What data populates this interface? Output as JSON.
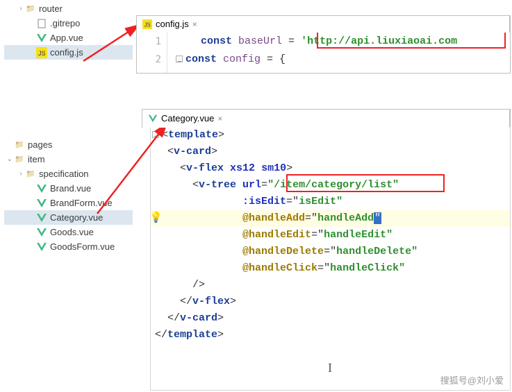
{
  "treeTop": {
    "rows": [
      {
        "indent": 1,
        "chevron": "›",
        "icon": "folder",
        "label": "router"
      },
      {
        "indent": 2,
        "chevron": "",
        "icon": "file",
        "label": ".gitrepo"
      },
      {
        "indent": 2,
        "chevron": "",
        "icon": "vue",
        "label": "App.vue"
      },
      {
        "indent": 2,
        "chevron": "",
        "icon": "js",
        "label": "config.js",
        "selected": true
      }
    ]
  },
  "tabTop": {
    "icon": "js",
    "label": "config.js",
    "close": "×"
  },
  "editorTop": {
    "ln1": "1",
    "ln2": "2",
    "l1_kw": "const ",
    "l1_ident": "baseUrl",
    "l1_eq": " = ",
    "l1_qo": "'",
    "l1_str": "http://api.liuxiaoai.com",
    "l2_kw": "const ",
    "l2_ident": "config",
    "l2_rest": " = {"
  },
  "treeBot": {
    "rows": [
      {
        "indent": 0,
        "chevron": "",
        "icon": "folder",
        "label": "pages"
      },
      {
        "indent": 0,
        "chevron": "⌄",
        "icon": "folder",
        "label": "item"
      },
      {
        "indent": 1,
        "chevron": "›",
        "icon": "folder",
        "label": "specification"
      },
      {
        "indent": 2,
        "chevron": "",
        "icon": "vue",
        "label": "Brand.vue"
      },
      {
        "indent": 2,
        "chevron": "",
        "icon": "vue",
        "label": "BrandForm.vue"
      },
      {
        "indent": 2,
        "chevron": "",
        "icon": "vue",
        "label": "Category.vue",
        "selected": true
      },
      {
        "indent": 2,
        "chevron": "",
        "icon": "vue",
        "label": "Goods.vue"
      },
      {
        "indent": 2,
        "chevron": "",
        "icon": "vue",
        "label": "GoodsForm.vue"
      }
    ]
  },
  "tabBot": {
    "icon": "vue",
    "label": "Category.vue",
    "close": "×"
  },
  "code": {
    "l1_a": "<",
    "l1_b": "template",
    "l1_c": ">",
    "l2_a": "  <",
    "l2_b": "v-card",
    "l2_c": ">",
    "l3_a": "    <",
    "l3_b": "v-flex",
    "l3_sp": " ",
    "l3_at1": "xs12",
    "l3_at2": "sm10",
    "l3_c": ">",
    "l4_a": "      <",
    "l4_b": "v-tree",
    "l4_sp": " ",
    "l4_at": "url",
    "l4_eq": "=",
    "l4_q": "\"",
    "l4_val": "/item/category/list",
    "l5_pad": "              ",
    "l5_at": ":isEdit",
    "l5_eq": "=\"",
    "l5_val": "isEdit",
    "l5_q2": "\"",
    "l6_pad": "              ",
    "l6_at": "@handleAdd",
    "l6_eq": "=\"",
    "l6_val": "handleAdd",
    "l6_q2": "\"",
    "l7_pad": "              ",
    "l7_at": "@handleEdit",
    "l7_eq": "=\"",
    "l7_val": "handleEdit",
    "l7_q2": "\"",
    "l8_pad": "              ",
    "l8_at": "@handleDelete",
    "l8_eq": "=\"",
    "l8_val": "handleDelete",
    "l8_q2": "\"",
    "l9_pad": "              ",
    "l9_at": "@handleClick",
    "l9_eq": "=\"",
    "l9_val": "handleClick",
    "l9_q2": "\"",
    "l10": "      />",
    "l11_a": "    </",
    "l11_b": "v-flex",
    "l11_c": ">",
    "l12_a": "  </",
    "l12_b": "v-card",
    "l12_c": ">",
    "l13_a": "</",
    "l13_b": "template",
    "l13_c": ">"
  },
  "watermark": "搜狐号@刘小爱",
  "caret": "I"
}
